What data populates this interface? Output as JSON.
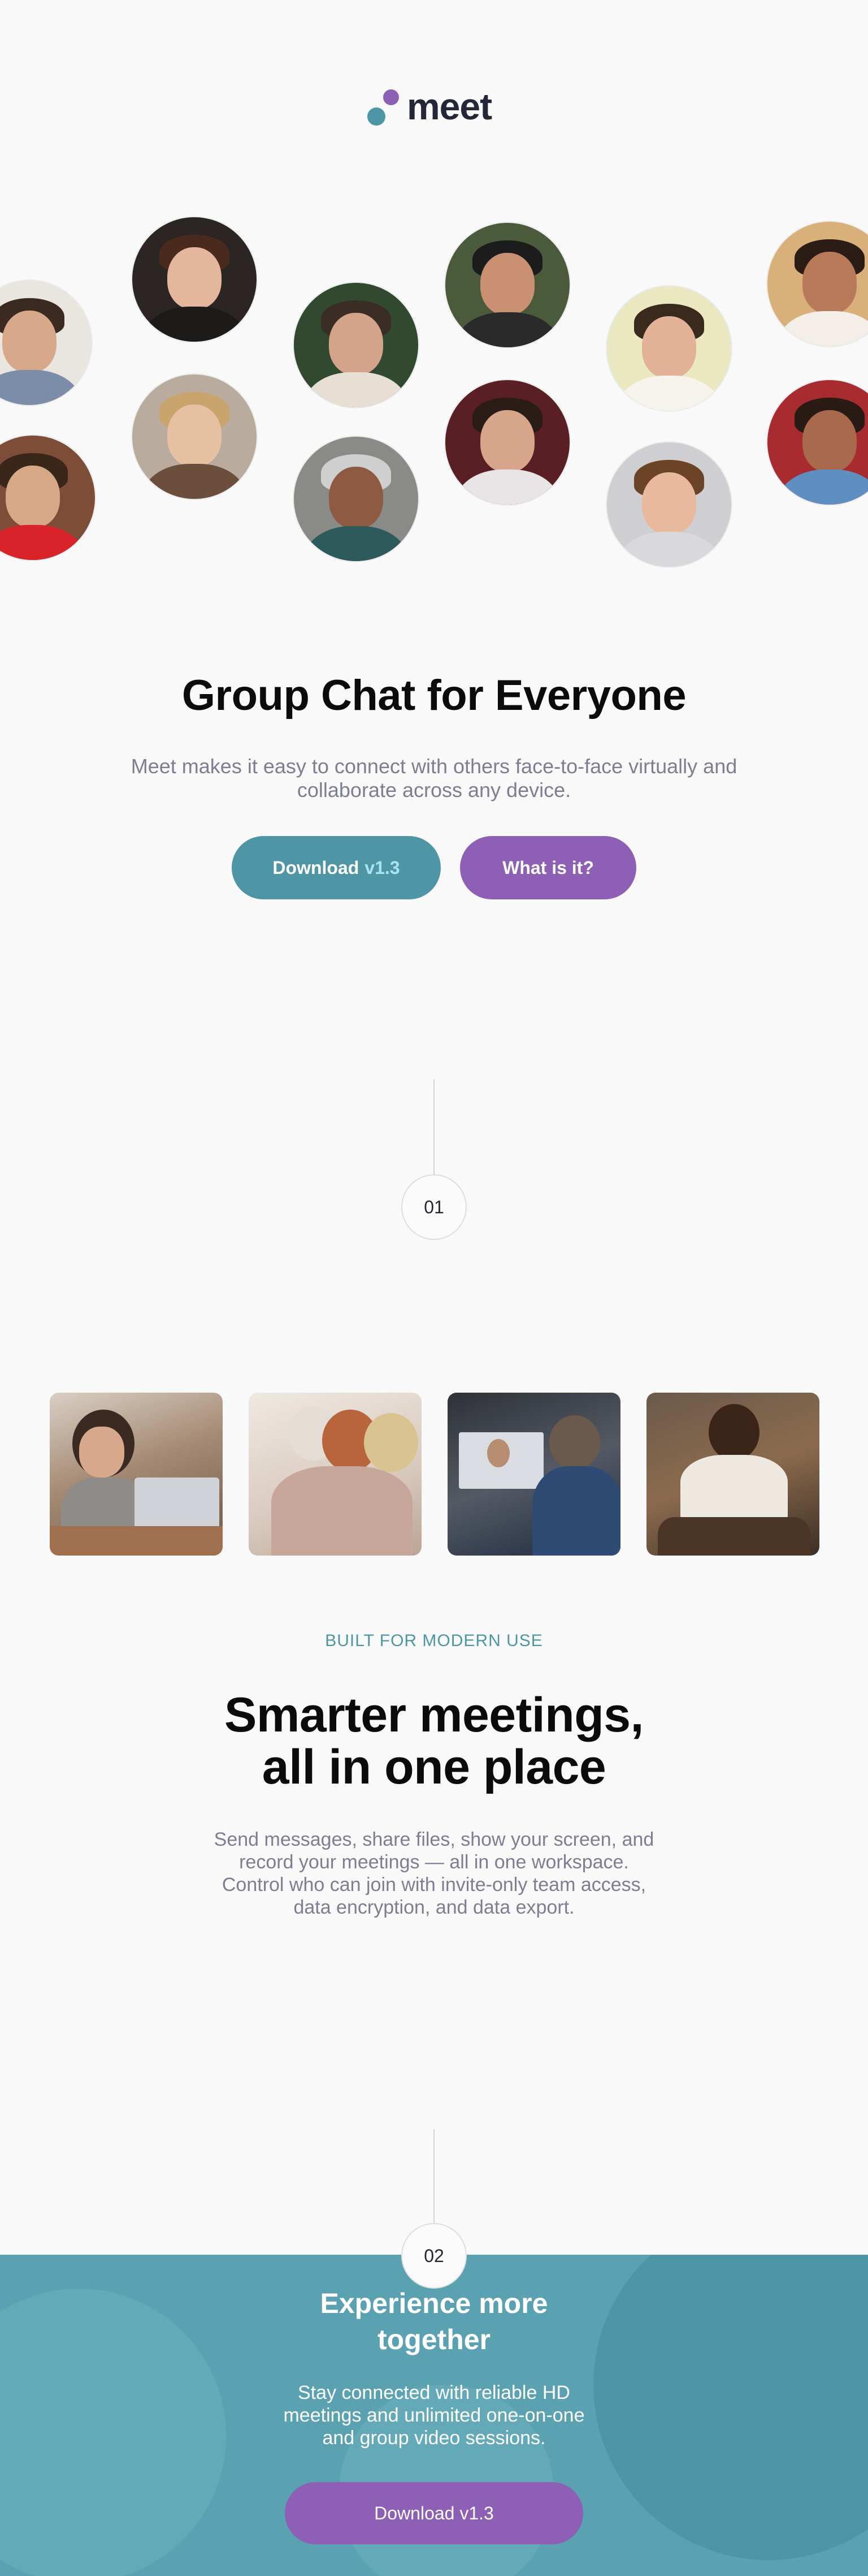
{
  "brand": {
    "name": "meet",
    "colors": {
      "teal": "#4e96a6",
      "purple": "#8d5fb5",
      "dark": "#252638",
      "muted": "#7d7e93"
    }
  },
  "hero": {
    "title": "Group Chat for Everyone",
    "subtitle": "Meet makes it easy to connect with others face-to-face virtually and collaborate across any device.",
    "download_label": "Download",
    "download_version": "v1.3",
    "what_label": "What is it?",
    "avatars": [
      "avatar-1",
      "avatar-2",
      "avatar-3",
      "avatar-4",
      "avatar-5",
      "avatar-6",
      "avatar-7",
      "avatar-8",
      "avatar-9",
      "avatar-10",
      "avatar-11",
      "avatar-12",
      "avatar-13"
    ]
  },
  "section1": {
    "step": "01",
    "photos": [
      "photo-woman-laptop",
      "photo-three-women-phone",
      "photo-video-call",
      "photo-man-phone"
    ],
    "eyebrow": "BUILT FOR MODERN USE",
    "title_line1": "Smarter meetings,",
    "title_line2": "all in one place",
    "body": "Send messages, share files, show your screen, and record your meetings — all in one workspace. Control who can join with invite-only team access, data encryption, and data export."
  },
  "section2": {
    "step": "02",
    "title_line1": "Experience more",
    "title_line2": "together",
    "body": "Stay connected with reliable HD meetings and unlimited one-on-one and group video sessions.",
    "download_label": "Download v1.3"
  }
}
